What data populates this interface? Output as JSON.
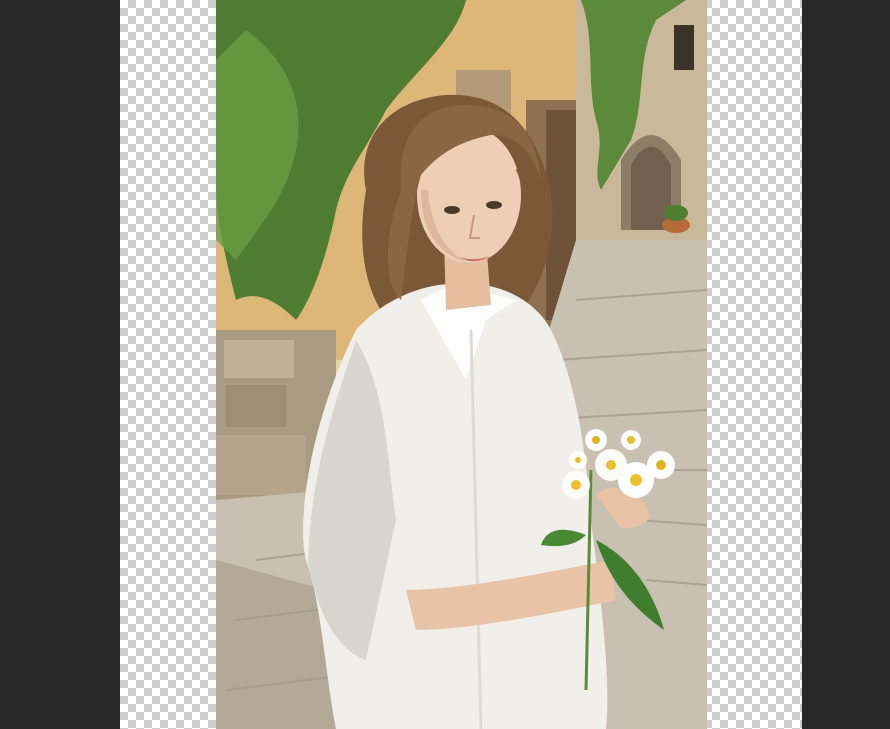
{
  "app": {
    "mode": "image-editor-canvas"
  },
  "canvas": {
    "transparent_pattern": "checkerboard",
    "checker_colors": [
      "#ffffff",
      "#cccccc"
    ],
    "workspace_color": "#282828"
  },
  "photo": {
    "subject": "portrait-photo",
    "icons": [
      "photo-layer"
    ]
  }
}
